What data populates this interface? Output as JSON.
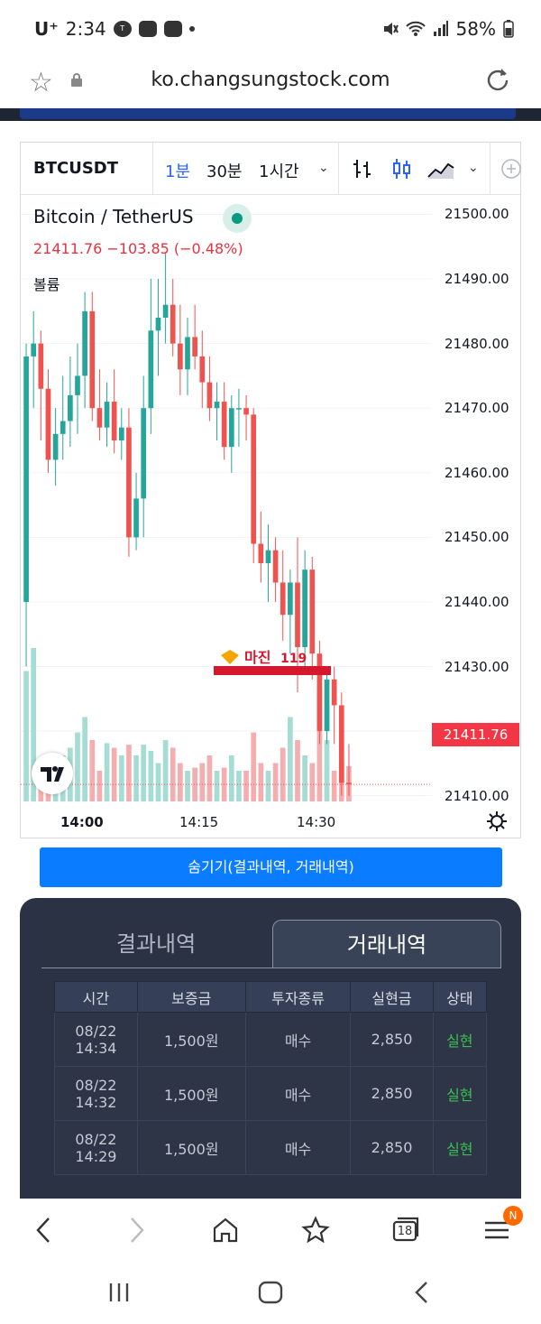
{
  "status_bar": {
    "carrier": "U⁺",
    "time": "2:34",
    "battery": "58%",
    "notification_icons": [
      "talk-icon",
      "message-icon",
      "clock-app-icon"
    ],
    "system_icons": [
      "mute-icon",
      "wifi-icon",
      "signal-icon",
      "battery-icon"
    ]
  },
  "browser": {
    "url": "ko.changsungstock.com",
    "tab_count": "18",
    "menu_badge": "N"
  },
  "chart_toolbar": {
    "symbol": "BTCUSDT",
    "intervals": [
      "1분",
      "30분",
      "1시간"
    ],
    "active_interval": "1분"
  },
  "chart_legend": {
    "title": "Bitcoin / TetherUS",
    "price_line": "21411.76  −103.85 (−0.48%)",
    "volume_label": "볼륨",
    "current_price_tag": "21411.76"
  },
  "chart_data": {
    "type": "candlestick",
    "symbol": "BTCUSDT",
    "interval": "1분",
    "y_ticks": [
      "21500.00",
      "21490.00",
      "21480.00",
      "21470.00",
      "21460.00",
      "21450.00",
      "21440.00",
      "21430.00",
      "21420.00",
      "21410.00"
    ],
    "ylim": [
      21408,
      21503
    ],
    "x_ticks": [
      "14:00",
      "14:15",
      "14:30"
    ],
    "last_price": 21411.76,
    "change": -103.85,
    "change_pct": -0.48,
    "candles": [
      {
        "o": 21440,
        "h": 21480,
        "l": 21430,
        "c": 21478,
        "v": 0.85
      },
      {
        "o": 21478,
        "h": 21485,
        "l": 21470,
        "c": 21480,
        "v": 1.0
      },
      {
        "o": 21480,
        "h": 21482,
        "l": 21465,
        "c": 21473,
        "v": 0.2
      },
      {
        "o": 21473,
        "h": 21476,
        "l": 21460,
        "c": 21462,
        "v": 0.3
      },
      {
        "o": 21462,
        "h": 21470,
        "l": 21458,
        "c": 21466,
        "v": 0.15
      },
      {
        "o": 21466,
        "h": 21475,
        "l": 21462,
        "c": 21468,
        "v": 0.3
      },
      {
        "o": 21468,
        "h": 21478,
        "l": 21464,
        "c": 21472,
        "v": 0.35
      },
      {
        "o": 21472,
        "h": 21480,
        "l": 21466,
        "c": 21475,
        "v": 0.45
      },
      {
        "o": 21475,
        "h": 21488,
        "l": 21470,
        "c": 21485,
        "v": 0.55
      },
      {
        "o": 21485,
        "h": 21488,
        "l": 21468,
        "c": 21470,
        "v": 0.4
      },
      {
        "o": 21470,
        "h": 21476,
        "l": 21465,
        "c": 21467,
        "v": 0.2
      },
      {
        "o": 21467,
        "h": 21474,
        "l": 21464,
        "c": 21471,
        "v": 0.38
      },
      {
        "o": 21471,
        "h": 21476,
        "l": 21463,
        "c": 21465,
        "v": 0.35
      },
      {
        "o": 21465,
        "h": 21470,
        "l": 21462,
        "c": 21467,
        "v": 0.3
      },
      {
        "o": 21467,
        "h": 21470,
        "l": 21447,
        "c": 21450,
        "v": 0.37
      },
      {
        "o": 21450,
        "h": 21460,
        "l": 21448,
        "c": 21456,
        "v": 0.3
      },
      {
        "o": 21456,
        "h": 21475,
        "l": 21450,
        "c": 21470,
        "v": 0.37
      },
      {
        "o": 21470,
        "h": 21490,
        "l": 21466,
        "c": 21482,
        "v": 0.33
      },
      {
        "o": 21482,
        "h": 21490,
        "l": 21475,
        "c": 21484,
        "v": 0.25
      },
      {
        "o": 21484,
        "h": 21494,
        "l": 21480,
        "c": 21486,
        "v": 0.4
      },
      {
        "o": 21486,
        "h": 21490,
        "l": 21478,
        "c": 21480,
        "v": 0.35
      },
      {
        "o": 21480,
        "h": 21486,
        "l": 21472,
        "c": 21476,
        "v": 0.25
      },
      {
        "o": 21476,
        "h": 21484,
        "l": 21472,
        "c": 21481,
        "v": 0.2
      },
      {
        "o": 21481,
        "h": 21486,
        "l": 21476,
        "c": 21478,
        "v": 0.22
      },
      {
        "o": 21478,
        "h": 21482,
        "l": 21470,
        "c": 21474,
        "v": 0.25
      },
      {
        "o": 21474,
        "h": 21478,
        "l": 21468,
        "c": 21470,
        "v": 0.3
      },
      {
        "o": 21470,
        "h": 21474,
        "l": 21465,
        "c": 21471,
        "v": 0.2
      },
      {
        "o": 21471,
        "h": 21474,
        "l": 21462,
        "c": 21464,
        "v": 0.22
      },
      {
        "o": 21464,
        "h": 21472,
        "l": 21460,
        "c": 21470,
        "v": 0.3
      },
      {
        "o": 21470,
        "h": 21473,
        "l": 21464,
        "c": 21470,
        "v": 0.2
      },
      {
        "o": 21470,
        "h": 21472,
        "l": 21465,
        "c": 21469,
        "v": 0.2
      },
      {
        "o": 21469,
        "h": 21470,
        "l": 21446,
        "c": 21449,
        "v": 0.45
      },
      {
        "o": 21449,
        "h": 21454,
        "l": 21443,
        "c": 21446,
        "v": 0.25
      },
      {
        "o": 21446,
        "h": 21452,
        "l": 21440,
        "c": 21448,
        "v": 0.2
      },
      {
        "o": 21448,
        "h": 21450,
        "l": 21440,
        "c": 21443,
        "v": 0.25
      },
      {
        "o": 21443,
        "h": 21448,
        "l": 21434,
        "c": 21438,
        "v": 0.35
      },
      {
        "o": 21438,
        "h": 21445,
        "l": 21432,
        "c": 21443,
        "v": 0.55
      },
      {
        "o": 21443,
        "h": 21450,
        "l": 21426,
        "c": 21433,
        "v": 0.4
      },
      {
        "o": 21433,
        "h": 21448,
        "l": 21430,
        "c": 21445,
        "v": 0.3
      },
      {
        "o": 21445,
        "h": 21447,
        "l": 21428,
        "c": 21432,
        "v": 0.25
      },
      {
        "o": 21432,
        "h": 21434,
        "l": 21418,
        "c": 21420,
        "v": 0.75
      },
      {
        "o": 21420,
        "h": 21430,
        "l": 21418,
        "c": 21428,
        "v": 0.4
      },
      {
        "o": 21428,
        "h": 21430,
        "l": 21418,
        "c": 21424,
        "v": 0.2
      },
      {
        "o": 21424,
        "h": 21426,
        "l": 21410,
        "c": 21412,
        "v": 0.25
      },
      {
        "o": 21412,
        "h": 21418,
        "l": 21410,
        "c": 21411.76,
        "v": 0.23
      }
    ]
  },
  "hide_button": {
    "label": "숨기기(결과내역, 거래내역)"
  },
  "panel": {
    "tabs": [
      "결과내역",
      "거래내역"
    ],
    "active_tab": "거래내역",
    "table": {
      "headers": [
        "시간",
        "보증금",
        "투자종류",
        "실현금",
        "상태"
      ],
      "rows": [
        {
          "date": "08/22",
          "time": "14:34",
          "deposit": "1,500원",
          "type": "매수",
          "realized": "2,850",
          "status": "실현"
        },
        {
          "date": "08/22",
          "time": "14:32",
          "deposit": "1,500원",
          "type": "매수",
          "realized": "2,850",
          "status": "실현"
        },
        {
          "date": "08/22",
          "time": "14:29",
          "deposit": "1,500원",
          "type": "매수",
          "realized": "2,850",
          "status": "실현"
        }
      ]
    }
  },
  "colors": {
    "up": "#26a69a",
    "down": "#ef5350",
    "accent": "#0a7cff",
    "panel_bg": "#2a3243",
    "status_ok": "#3bbf52"
  }
}
